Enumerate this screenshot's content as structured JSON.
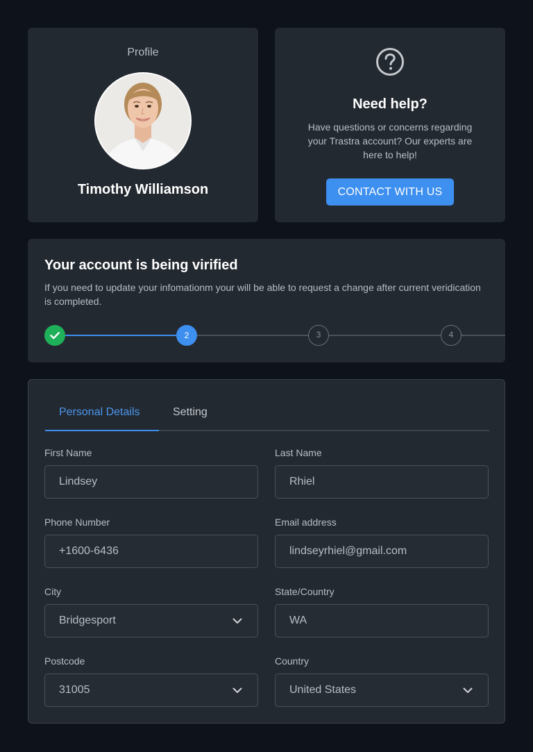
{
  "profile": {
    "label": "Profile",
    "name": "Timothy Williamson"
  },
  "help": {
    "title": "Need help?",
    "description": "Have questions or concerns regarding your Trastra account? Our experts are here to help!",
    "button_label": "CONTACT WITH US",
    "icon": "question-circle-icon"
  },
  "verification": {
    "title": "Your account is being virified",
    "description": "If you need to update your infomationm your will be able to request a change after current veridication is completed.",
    "steps": [
      {
        "label": "",
        "state": "done"
      },
      {
        "label": "2",
        "state": "active"
      },
      {
        "label": "3",
        "state": "todo"
      },
      {
        "label": "4",
        "state": "todo"
      }
    ]
  },
  "form": {
    "tabs": [
      {
        "label": "Personal Details",
        "active": true
      },
      {
        "label": "Setting",
        "active": false
      }
    ],
    "fields": {
      "first_name": {
        "label": "First Name",
        "value": "Lindsey"
      },
      "last_name": {
        "label": "Last Name",
        "value": "Rhiel"
      },
      "phone": {
        "label": "Phone Number",
        "value": "+1600-6436"
      },
      "email": {
        "label": "Email address",
        "value": "lindseyrhiel@gmail.com"
      },
      "city": {
        "label": "City",
        "value": "Bridgesport"
      },
      "state": {
        "label": "State/Country",
        "value": "WA"
      },
      "postcode": {
        "label": "Postcode",
        "value": "31005"
      },
      "country": {
        "label": "Country",
        "value": "United States"
      }
    }
  },
  "colors": {
    "background": "#0e121a",
    "card": "#232930",
    "accent": "#3d8ff0",
    "success": "#1fb05a"
  }
}
